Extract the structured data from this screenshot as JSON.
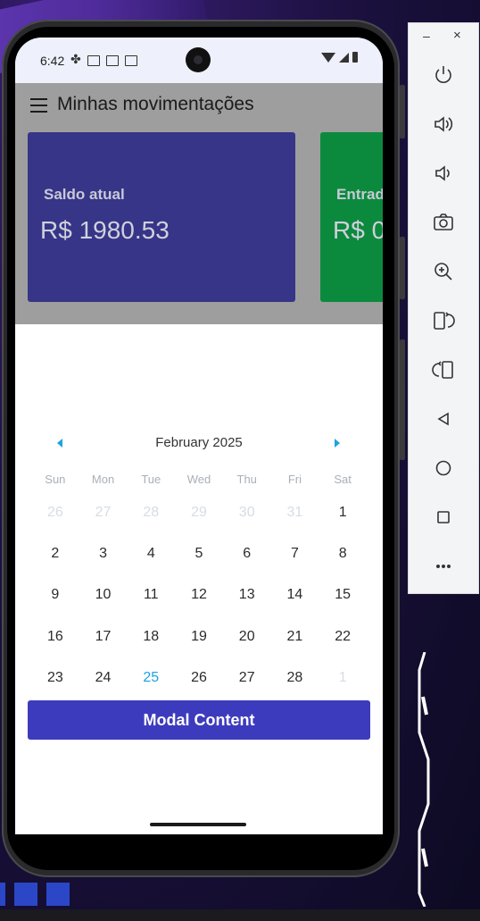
{
  "status_bar": {
    "time": "6:42"
  },
  "app": {
    "title": "Minhas movimentações",
    "cards": [
      {
        "label": "Saldo atual",
        "value": "R$ 1980.53"
      },
      {
        "label": "Entrad",
        "value": "R$ 0"
      }
    ]
  },
  "calendar": {
    "month_label": "February 2025",
    "weekdays": [
      "Sun",
      "Mon",
      "Tue",
      "Wed",
      "Thu",
      "Fri",
      "Sat"
    ],
    "days": [
      {
        "d": "26",
        "other": true
      },
      {
        "d": "27",
        "other": true
      },
      {
        "d": "28",
        "other": true
      },
      {
        "d": "29",
        "other": true
      },
      {
        "d": "30",
        "other": true
      },
      {
        "d": "31",
        "other": true
      },
      {
        "d": "1"
      },
      {
        "d": "2"
      },
      {
        "d": "3"
      },
      {
        "d": "4"
      },
      {
        "d": "5"
      },
      {
        "d": "6"
      },
      {
        "d": "7"
      },
      {
        "d": "8"
      },
      {
        "d": "9"
      },
      {
        "d": "10"
      },
      {
        "d": "11"
      },
      {
        "d": "12"
      },
      {
        "d": "13"
      },
      {
        "d": "14"
      },
      {
        "d": "15"
      },
      {
        "d": "16"
      },
      {
        "d": "17"
      },
      {
        "d": "18"
      },
      {
        "d": "19"
      },
      {
        "d": "20"
      },
      {
        "d": "21"
      },
      {
        "d": "22"
      },
      {
        "d": "23"
      },
      {
        "d": "24"
      },
      {
        "d": "25",
        "today": true
      },
      {
        "d": "26"
      },
      {
        "d": "27"
      },
      {
        "d": "28"
      },
      {
        "d": "1",
        "other": true
      }
    ],
    "accent_color": "#1ca4e0"
  },
  "modal_button_label": "Modal Content",
  "emulator_toolbar": {
    "window_controls": {
      "minimize": "–",
      "close": "×"
    },
    "buttons": [
      {
        "name": "power-icon"
      },
      {
        "name": "volume-up-icon"
      },
      {
        "name": "volume-down-icon"
      },
      {
        "name": "camera-icon"
      },
      {
        "name": "zoom-in-icon"
      },
      {
        "name": "rotate-right-icon"
      },
      {
        "name": "rotate-left-icon"
      },
      {
        "name": "back-icon"
      },
      {
        "name": "home-icon"
      },
      {
        "name": "overview-icon"
      },
      {
        "name": "more-icon"
      }
    ]
  },
  "colors": {
    "balance_card": "#363588",
    "income_card": "#0b8a3d",
    "modal_button": "#3d3bbd"
  }
}
